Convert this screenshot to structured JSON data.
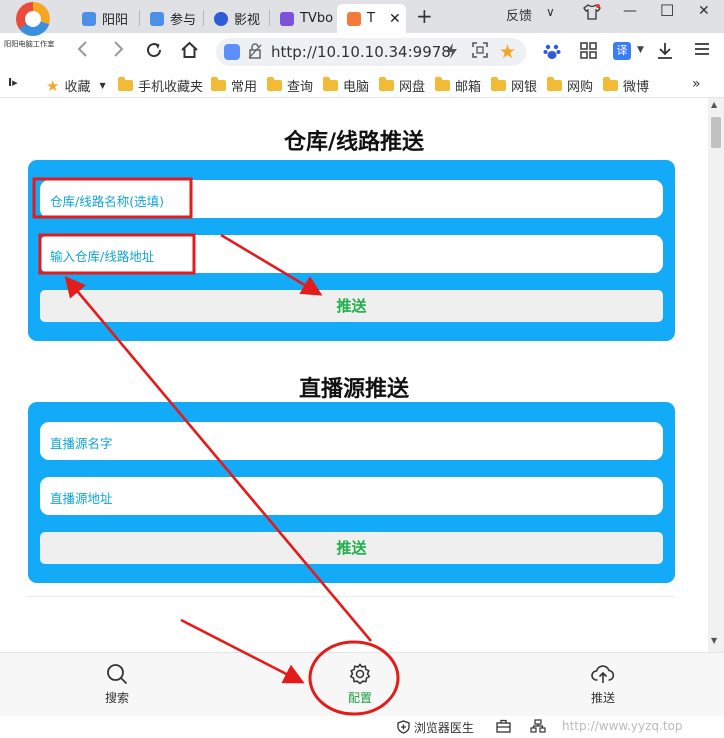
{
  "browser": {
    "logo_text": "阳阳电脑工作室",
    "tabs": [
      {
        "title": "阳阳",
        "color": "#4a8fe8"
      },
      {
        "title": "参与",
        "color": "#4a8fe8"
      },
      {
        "title": "影视",
        "color": "#2f5bd8"
      },
      {
        "title": "TVbo",
        "color": "#7b52d9"
      },
      {
        "title": "T",
        "color": "#f27a3a"
      }
    ],
    "active_tab_close": "✕",
    "new_tab": "+",
    "feedback": "反馈",
    "window_controls": {
      "minimize": "—",
      "maximize": "☐",
      "close": "✕"
    },
    "url": "http://10.10.10.34:9978",
    "translate_label": "译"
  },
  "bookmarks": {
    "collect_label": "收藏",
    "items": [
      "手机收藏夹",
      "常用",
      "查询",
      "电脑",
      "网盘",
      "邮箱",
      "网银",
      "网购",
      "微博"
    ],
    "more": "»"
  },
  "warehouse_section": {
    "title": "仓库/线路推送",
    "name_placeholder": "仓库/线路名称(选填)",
    "address_placeholder": "输入仓库/线路地址",
    "push_label": "推送"
  },
  "live_section": {
    "title": "直播源推送",
    "name_placeholder": "直播源名字",
    "address_placeholder": "直播源地址",
    "push_label": "推送"
  },
  "bottom_nav": {
    "search_label": "搜索",
    "config_label": "配置",
    "push_label": "推送"
  },
  "status_bar": {
    "doctor": "浏览器医生",
    "watermark": "http://www.yyzq.top"
  },
  "colors": {
    "panel_blue": "#13aaf8",
    "push_green": "#20b14a",
    "placeholder_cyan": "#11a5d8",
    "annotation_red": "#e41b1b"
  }
}
